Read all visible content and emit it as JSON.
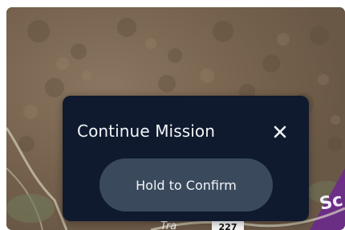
{
  "dialog": {
    "title": "Continue Mission",
    "confirm_label": "Hold to Confirm",
    "close_icon": "close-icon"
  },
  "map": {
    "street_label_fragment": "Tra",
    "shield_fragment": "227",
    "overlay_label_fragment": "Sc"
  },
  "colors": {
    "dialog_background": "#0f1a2e",
    "confirm_button": "#3a4a5c",
    "text": "#f2f4f8",
    "overlay_purple": "#6c2a8c",
    "terrain": "#7d6a55"
  }
}
